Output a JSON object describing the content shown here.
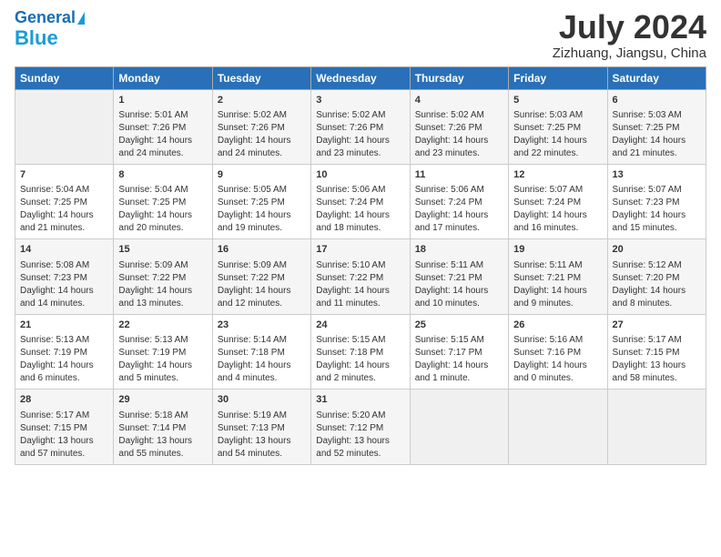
{
  "header": {
    "logo_line1": "General",
    "logo_line2": "Blue",
    "month": "July 2024",
    "location": "Zizhuang, Jiangsu, China"
  },
  "days_of_week": [
    "Sunday",
    "Monday",
    "Tuesday",
    "Wednesday",
    "Thursday",
    "Friday",
    "Saturday"
  ],
  "weeks": [
    [
      {
        "day": "",
        "info": ""
      },
      {
        "day": "1",
        "info": "Sunrise: 5:01 AM\nSunset: 7:26 PM\nDaylight: 14 hours\nand 24 minutes."
      },
      {
        "day": "2",
        "info": "Sunrise: 5:02 AM\nSunset: 7:26 PM\nDaylight: 14 hours\nand 24 minutes."
      },
      {
        "day": "3",
        "info": "Sunrise: 5:02 AM\nSunset: 7:26 PM\nDaylight: 14 hours\nand 23 minutes."
      },
      {
        "day": "4",
        "info": "Sunrise: 5:02 AM\nSunset: 7:26 PM\nDaylight: 14 hours\nand 23 minutes."
      },
      {
        "day": "5",
        "info": "Sunrise: 5:03 AM\nSunset: 7:25 PM\nDaylight: 14 hours\nand 22 minutes."
      },
      {
        "day": "6",
        "info": "Sunrise: 5:03 AM\nSunset: 7:25 PM\nDaylight: 14 hours\nand 21 minutes."
      }
    ],
    [
      {
        "day": "7",
        "info": "Sunrise: 5:04 AM\nSunset: 7:25 PM\nDaylight: 14 hours\nand 21 minutes."
      },
      {
        "day": "8",
        "info": "Sunrise: 5:04 AM\nSunset: 7:25 PM\nDaylight: 14 hours\nand 20 minutes."
      },
      {
        "day": "9",
        "info": "Sunrise: 5:05 AM\nSunset: 7:25 PM\nDaylight: 14 hours\nand 19 minutes."
      },
      {
        "day": "10",
        "info": "Sunrise: 5:06 AM\nSunset: 7:24 PM\nDaylight: 14 hours\nand 18 minutes."
      },
      {
        "day": "11",
        "info": "Sunrise: 5:06 AM\nSunset: 7:24 PM\nDaylight: 14 hours\nand 17 minutes."
      },
      {
        "day": "12",
        "info": "Sunrise: 5:07 AM\nSunset: 7:24 PM\nDaylight: 14 hours\nand 16 minutes."
      },
      {
        "day": "13",
        "info": "Sunrise: 5:07 AM\nSunset: 7:23 PM\nDaylight: 14 hours\nand 15 minutes."
      }
    ],
    [
      {
        "day": "14",
        "info": "Sunrise: 5:08 AM\nSunset: 7:23 PM\nDaylight: 14 hours\nand 14 minutes."
      },
      {
        "day": "15",
        "info": "Sunrise: 5:09 AM\nSunset: 7:22 PM\nDaylight: 14 hours\nand 13 minutes."
      },
      {
        "day": "16",
        "info": "Sunrise: 5:09 AM\nSunset: 7:22 PM\nDaylight: 14 hours\nand 12 minutes."
      },
      {
        "day": "17",
        "info": "Sunrise: 5:10 AM\nSunset: 7:22 PM\nDaylight: 14 hours\nand 11 minutes."
      },
      {
        "day": "18",
        "info": "Sunrise: 5:11 AM\nSunset: 7:21 PM\nDaylight: 14 hours\nand 10 minutes."
      },
      {
        "day": "19",
        "info": "Sunrise: 5:11 AM\nSunset: 7:21 PM\nDaylight: 14 hours\nand 9 minutes."
      },
      {
        "day": "20",
        "info": "Sunrise: 5:12 AM\nSunset: 7:20 PM\nDaylight: 14 hours\nand 8 minutes."
      }
    ],
    [
      {
        "day": "21",
        "info": "Sunrise: 5:13 AM\nSunset: 7:19 PM\nDaylight: 14 hours\nand 6 minutes."
      },
      {
        "day": "22",
        "info": "Sunrise: 5:13 AM\nSunset: 7:19 PM\nDaylight: 14 hours\nand 5 minutes."
      },
      {
        "day": "23",
        "info": "Sunrise: 5:14 AM\nSunset: 7:18 PM\nDaylight: 14 hours\nand 4 minutes."
      },
      {
        "day": "24",
        "info": "Sunrise: 5:15 AM\nSunset: 7:18 PM\nDaylight: 14 hours\nand 2 minutes."
      },
      {
        "day": "25",
        "info": "Sunrise: 5:15 AM\nSunset: 7:17 PM\nDaylight: 14 hours\nand 1 minute."
      },
      {
        "day": "26",
        "info": "Sunrise: 5:16 AM\nSunset: 7:16 PM\nDaylight: 14 hours\nand 0 minutes."
      },
      {
        "day": "27",
        "info": "Sunrise: 5:17 AM\nSunset: 7:15 PM\nDaylight: 13 hours\nand 58 minutes."
      }
    ],
    [
      {
        "day": "28",
        "info": "Sunrise: 5:17 AM\nSunset: 7:15 PM\nDaylight: 13 hours\nand 57 minutes."
      },
      {
        "day": "29",
        "info": "Sunrise: 5:18 AM\nSunset: 7:14 PM\nDaylight: 13 hours\nand 55 minutes."
      },
      {
        "day": "30",
        "info": "Sunrise: 5:19 AM\nSunset: 7:13 PM\nDaylight: 13 hours\nand 54 minutes."
      },
      {
        "day": "31",
        "info": "Sunrise: 5:20 AM\nSunset: 7:12 PM\nDaylight: 13 hours\nand 52 minutes."
      },
      {
        "day": "",
        "info": ""
      },
      {
        "day": "",
        "info": ""
      },
      {
        "day": "",
        "info": ""
      }
    ]
  ]
}
